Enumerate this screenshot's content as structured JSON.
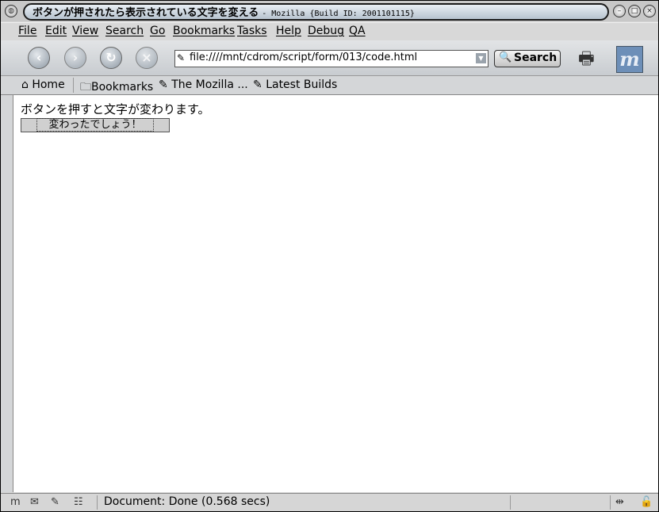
{
  "window": {
    "title": "ボタンが押されたら表示されている文字を変える",
    "title_suffix": "- Mozilla {Build ID: 2001101115}"
  },
  "menubar": {
    "items": [
      "File",
      "Edit",
      "View",
      "Search",
      "Go",
      "Bookmarks",
      "Tasks",
      "Help",
      "Debug",
      "QA"
    ]
  },
  "navbar": {
    "url": "file:////mnt/cdrom/script/form/013/code.html",
    "search_label": "Search",
    "logo": "m"
  },
  "personal_toolbar": {
    "home": "Home",
    "bookmarks": "Bookmarks",
    "mozilla": "The Mozilla ...",
    "latest_builds": "Latest Builds"
  },
  "page": {
    "text": "ボタンを押すと文字が変わります。",
    "button_label": "変わったでしょう！"
  },
  "statusbar": {
    "text": "Document: Done (0.568 secs)"
  },
  "icons": {
    "back": "back-icon",
    "forward": "forward-icon",
    "reload": "reload-icon",
    "stop": "stop-icon",
    "search": "magnifier-icon",
    "print": "print-icon"
  }
}
